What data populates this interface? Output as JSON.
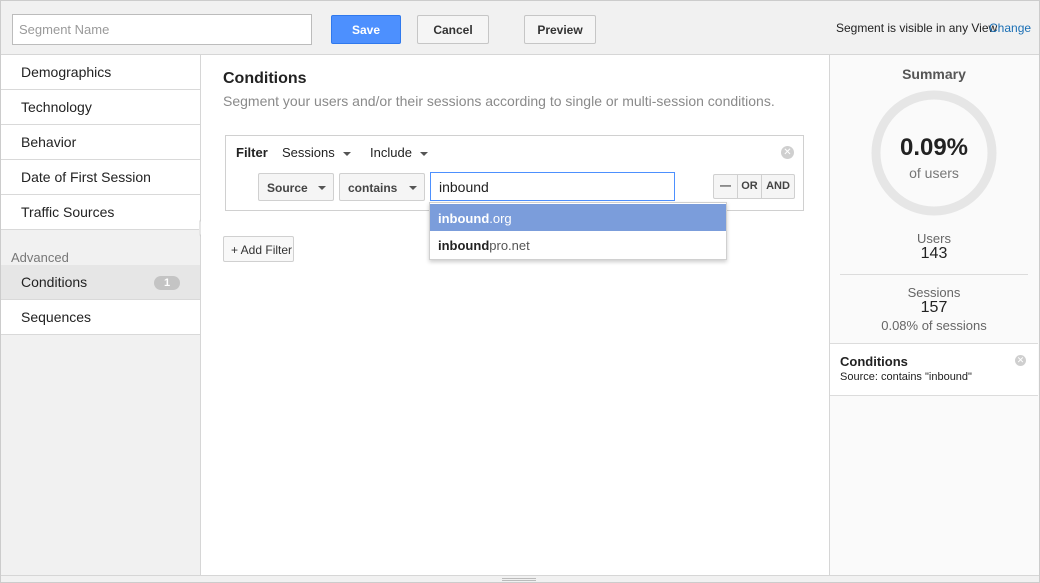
{
  "topbar": {
    "segment_name_placeholder": "Segment Name",
    "save_label": "Save",
    "cancel_label": "Cancel",
    "preview_label": "Preview",
    "visibility_text": "Segment is visible in any View",
    "change_label": "Change"
  },
  "sidebar": {
    "items": [
      {
        "label": "Demographics"
      },
      {
        "label": "Technology"
      },
      {
        "label": "Behavior"
      },
      {
        "label": "Date of First Session"
      },
      {
        "label": "Traffic Sources"
      }
    ],
    "advanced_label": "Advanced",
    "advanced_items": [
      {
        "label": "Conditions",
        "badge": "1"
      },
      {
        "label": "Sequences"
      }
    ]
  },
  "main": {
    "title": "Conditions",
    "subtitle": "Segment your users and/or their sessions according to single or multi-session conditions.",
    "filter": {
      "label": "Filter",
      "scope": "Sessions",
      "mode": "Include",
      "dimension": "Source",
      "operator": "contains",
      "value": "inbound",
      "remove_label": "—",
      "or_label": "OR",
      "and_label": "AND"
    },
    "add_filter_label": "+ Add Filter",
    "suggestions": [
      {
        "match": "inbound",
        "rest": ".org"
      },
      {
        "match": "inbound",
        "rest": "pro.net"
      }
    ]
  },
  "summary": {
    "title": "Summary",
    "percent": "0.09%",
    "percent_label": "of users",
    "users_label": "Users",
    "users_value": "143",
    "sessions_label": "Sessions",
    "sessions_value": "157",
    "sessions_pct": "0.08% of sessions",
    "conditions_title": "Conditions",
    "conditions_desc": "Source: contains \"inbound\""
  }
}
